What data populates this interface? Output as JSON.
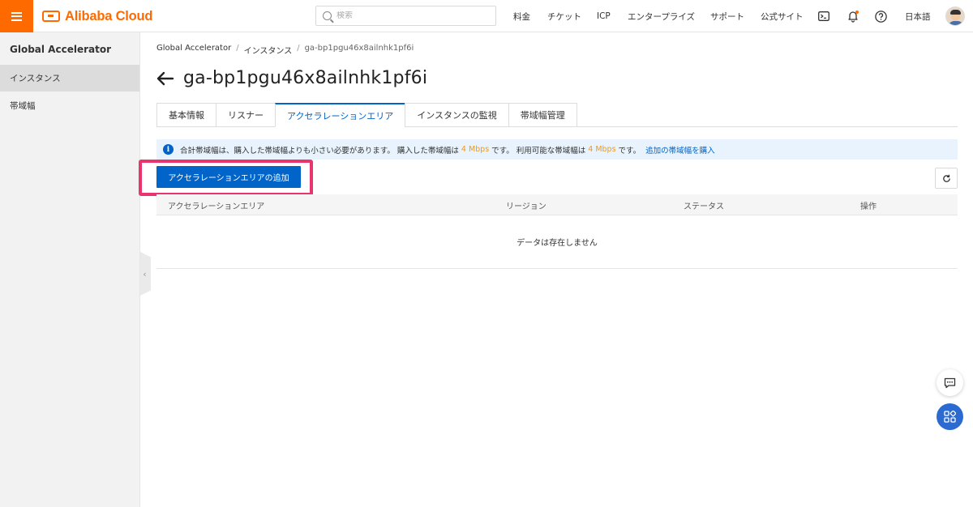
{
  "topbar": {
    "brand": "Alibaba Cloud",
    "search_placeholder": "検索",
    "nav": [
      "料金",
      "チケット",
      "ICP",
      "エンタープライズ",
      "サポート",
      "公式サイト"
    ],
    "language": "日本語",
    "colors": {
      "brand": "#ff6a00",
      "accent": "#0064c8",
      "notification_dot": "#ff6a00"
    }
  },
  "sidebar": {
    "title": "Global Accelerator",
    "items": [
      {
        "label": "インスタンス",
        "active": true
      },
      {
        "label": "帯域幅",
        "active": false
      }
    ]
  },
  "breadcrumb": [
    "Global Accelerator",
    "インスタンス",
    "ga-bp1pgu46x8ailnhk1pf6i"
  ],
  "page": {
    "title": "ga-bp1pgu46x8ailnhk1pf6i",
    "tabs": [
      {
        "label": "基本情報",
        "active": false
      },
      {
        "label": "リスナー",
        "active": false
      },
      {
        "label": "アクセラレーションエリア",
        "active": true
      },
      {
        "label": "インスタンスの監視",
        "active": false
      },
      {
        "label": "帯域幅管理",
        "active": false
      }
    ],
    "notice": {
      "part1": "合計帯域幅は、購入した帯域幅よりも小さい必要があります。 購入した帯域幅は",
      "value1": "4 Mbps",
      "part2": "です。 利用可能な帯域幅は",
      "value2": "4 Mbps",
      "part3": "です。",
      "link": "追加の帯域幅を購入"
    },
    "add_button": "アクセラレーションエリアの追加",
    "table": {
      "columns": [
        "アクセラレーションエリア",
        "リージョン",
        "ステータス",
        "操作"
      ],
      "empty_text": "データは存在しません"
    }
  }
}
